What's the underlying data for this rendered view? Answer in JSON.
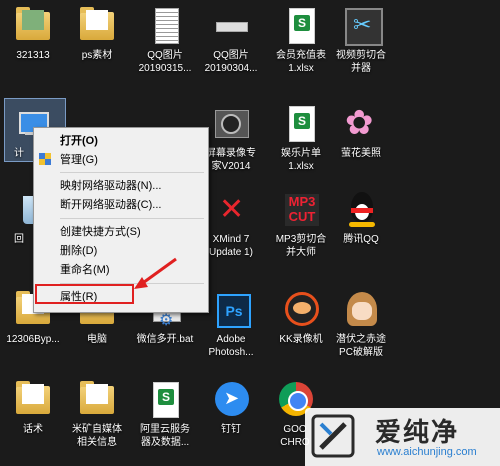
{
  "desktop_icons": [
    {
      "label": "321313",
      "kind": "folder-person"
    },
    {
      "label": "ps素材",
      "kind": "folder"
    },
    {
      "label": "QQ图片\n20190315...",
      "kind": "doc"
    },
    {
      "label": "QQ图片\n20190304...",
      "kind": "doc"
    },
    {
      "label": "会员充值表\n1.xlsx",
      "kind": "excel"
    },
    {
      "label": "视频剪切合\n并器",
      "kind": "scissors"
    },
    {
      "label": "计",
      "kind": "computer"
    },
    {
      "label": "屏幕录像专\n家V2014",
      "kind": "recorder"
    },
    {
      "label": "娱乐片单\n1.xlsx",
      "kind": "excel"
    },
    {
      "label": "萤花美照",
      "kind": "flower"
    },
    {
      "label": "回",
      "kind": "recycle"
    },
    {
      "label": "XMind 7\nUpdate 1)",
      "kind": "xmind"
    },
    {
      "label": "MP3剪切合\n并大师",
      "kind": "mp3"
    },
    {
      "label": "腾讯QQ",
      "kind": "qq"
    },
    {
      "label": "12306Byp...",
      "kind": "folder"
    },
    {
      "label": "电脑",
      "kind": "folder"
    },
    {
      "label": "微信多开.bat",
      "kind": "doc"
    },
    {
      "label": "Adobe\nPhotosh...",
      "kind": "ps"
    },
    {
      "label": "KK录像机",
      "kind": "kk"
    },
    {
      "label": "潜伏之赤途\nPC破解版",
      "kind": "anime"
    },
    {
      "label": "话术",
      "kind": "folder"
    },
    {
      "label": "米矿自媒体\n相关信息",
      "kind": "folder"
    },
    {
      "label": "阿里云服务\n器及数据...",
      "kind": "excel"
    },
    {
      "label": "钉钉",
      "kind": "dingtalk"
    },
    {
      "label": "GOO\nCHRO",
      "kind": "chrome"
    }
  ],
  "context_menu": {
    "open": "打开(O)",
    "manage": "管理(G)",
    "map_drive": "映射网络驱动器(N)...",
    "disconnect_drive": "断开网络驱动器(C)...",
    "create_shortcut": "创建快捷方式(S)",
    "delete": "删除(D)",
    "rename": "重命名(M)",
    "properties": "属性(R)"
  },
  "watermark": {
    "title": "爱纯净",
    "url": "www.aichunjing.com"
  },
  "colors": {
    "highlight": "#e02020",
    "excel": "#1e8e3e",
    "ps": "#2ea3ff"
  }
}
